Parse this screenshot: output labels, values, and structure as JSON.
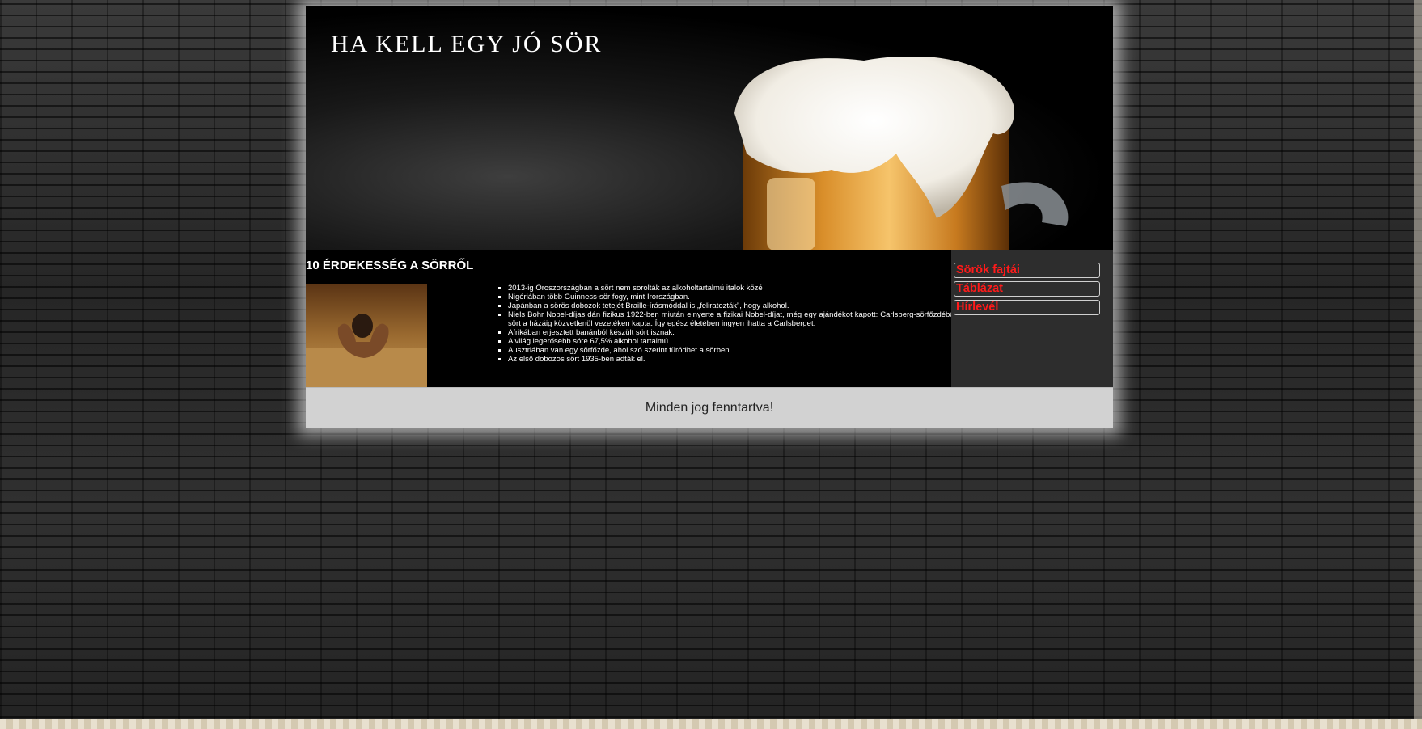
{
  "header": {
    "title": "HA KELL EGY JÓ SÖR"
  },
  "main": {
    "section_title": "10 ÉRDEKESSÉG A SÖRRŐL",
    "facts": [
      "2013-ig Oroszországban a sört nem sorolták az alkoholtartalmú italok közé",
      "Nigériában több Guinness-sör fogy, mint Írországban.",
      "Japánban a sörös dobozok tetejét Braille-írásmóddal is „feliratozták”, hogy alkohol.",
      "Niels Bohr Nobel-díjas dán fizikus 1922-ben miután elnyerte a fizikai Nobel-díjat, még egy ajándékot kapott: Carlsberg-sörfőzdéből a sört a házáig közvetlenül vezetéken kapta. Így egész életében ingyen ihatta a Carlsberget.",
      "Afrikában erjesztett banánból készült sört isznak.",
      "A világ legerősebb söre 67,5% alkohol tartalmú.",
      "Ausztriában van egy sörfőzde, ahol szó szerint fürödhet a sörben.",
      "Az első dobozos sört 1935-ben adták el."
    ]
  },
  "sidebar": {
    "items": [
      {
        "label": "Sörök fajtái"
      },
      {
        "label": "Táblázat"
      },
      {
        "label": "Hírlevél"
      }
    ]
  },
  "footer": {
    "text": "Minden jog fenntartva!"
  },
  "colors": {
    "nav_link": "#ff1a1a",
    "sidebar_bg": "#2d2d2d",
    "footer_bg": "#d2d2d2",
    "main_bg": "#000000"
  }
}
